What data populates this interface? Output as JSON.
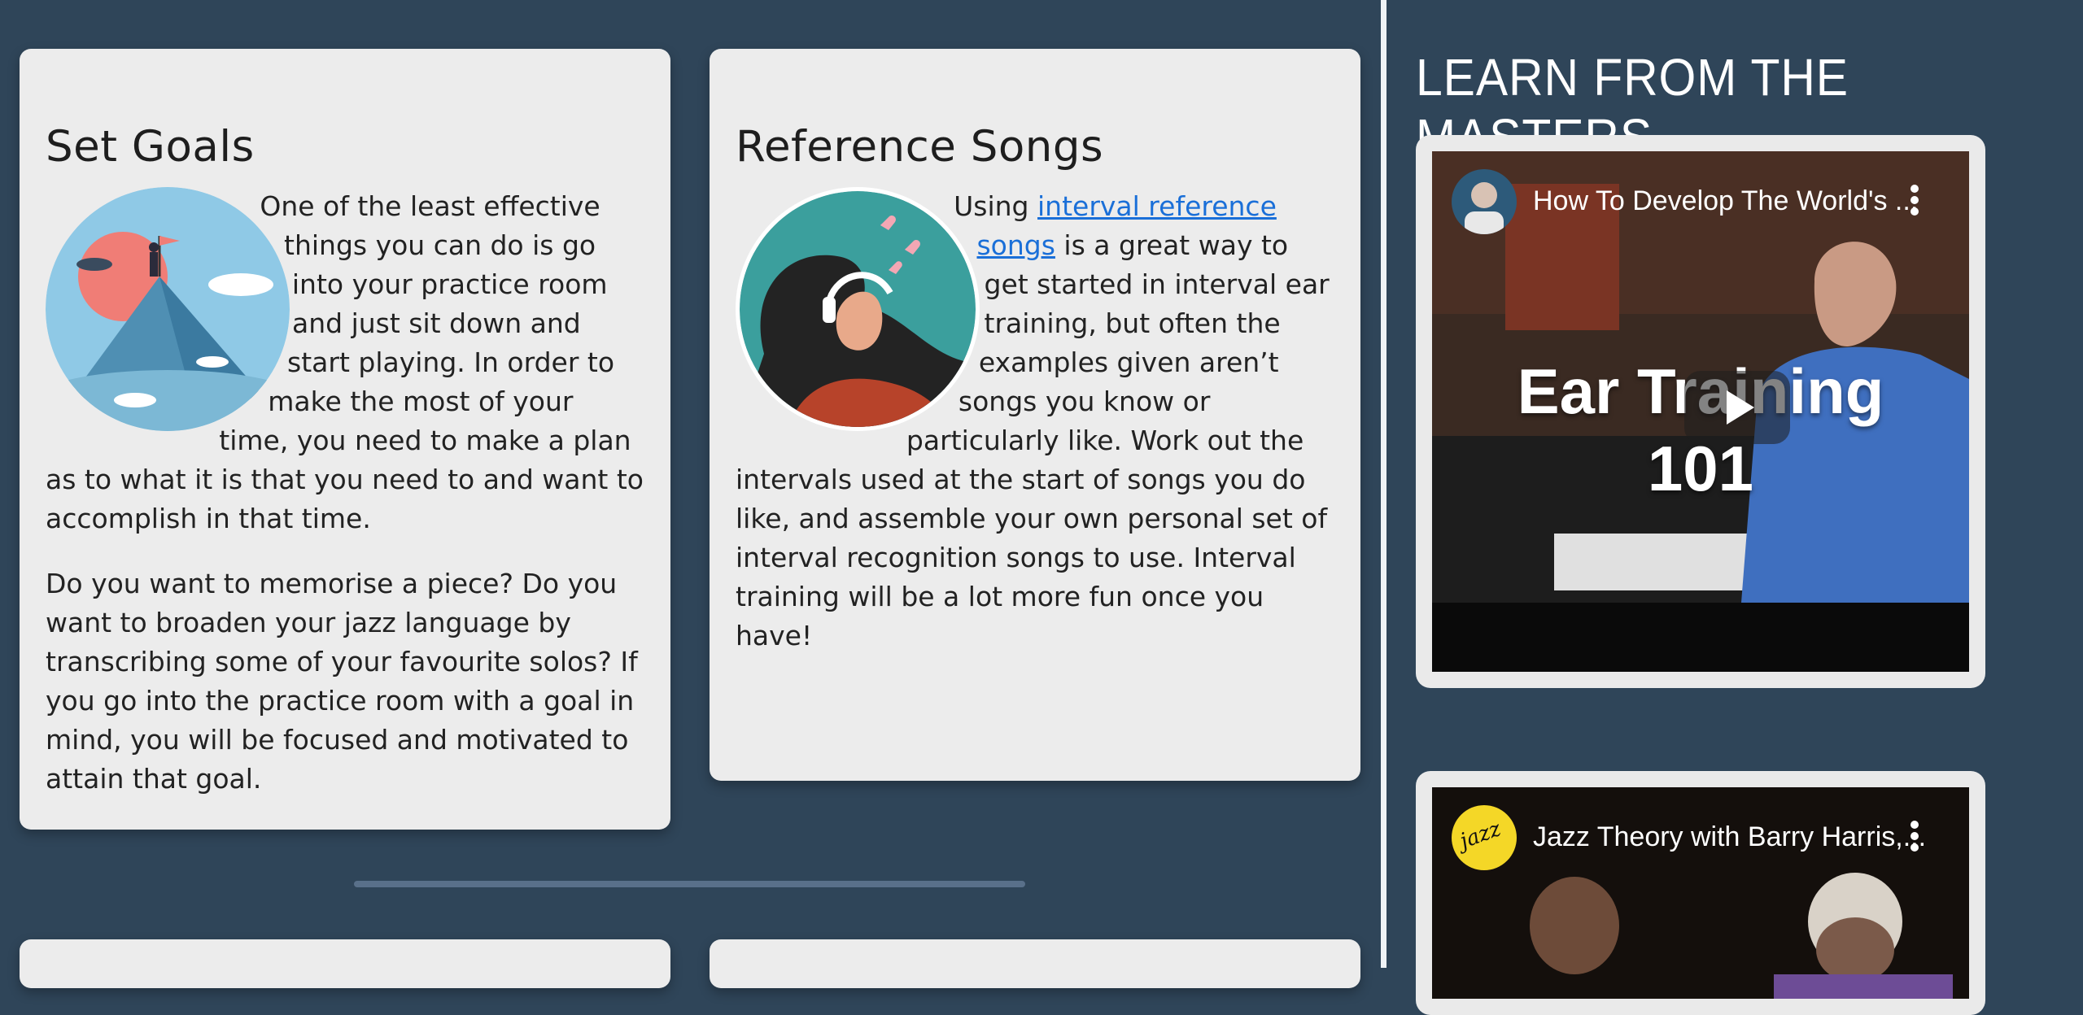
{
  "cards": {
    "set_goals": {
      "title": "Set Goals",
      "paragraph1": "One of the least effective things you can do is go into your practice room and just sit down and start playing. In order to make the most of your time, you need to make a plan as to what it is that you need to and want to accomplish in that time.",
      "paragraph2": "Do you want to memorise a piece? Do you want to broaden your jazz language by transcribing some of your favourite solos? If you go into the practice room with a goal in mind, you will be focused and motivated to attain that goal."
    },
    "reference_songs": {
      "title": "Reference Songs",
      "text_before_link": "Using ",
      "link_text": "interval reference songs",
      "text_after_link": " is a great way to get started in interval ear training, but often the examples given aren’t songs you know or particularly like. Work out the intervals used at the start of songs you do like, and assemble your own personal set of interval recognition songs to use. Interval training will be a lot more fun once you have!"
    }
  },
  "sidebar": {
    "title": "LEARN FROM THE MASTERS",
    "videos": [
      {
        "title": "How To Develop The World's ...",
        "overlay_line1": "Ear Training",
        "overlay_line2": "101",
        "avatar_icon": "channel-avatar-icon"
      },
      {
        "title": "Jazz Theory with Barry Harris,...",
        "avatar_text": "jazz",
        "avatar_icon": "jazz-logo-icon"
      }
    ]
  },
  "colors": {
    "background": "#2f4559",
    "card": "#ececec",
    "link": "#1a6fd8"
  }
}
